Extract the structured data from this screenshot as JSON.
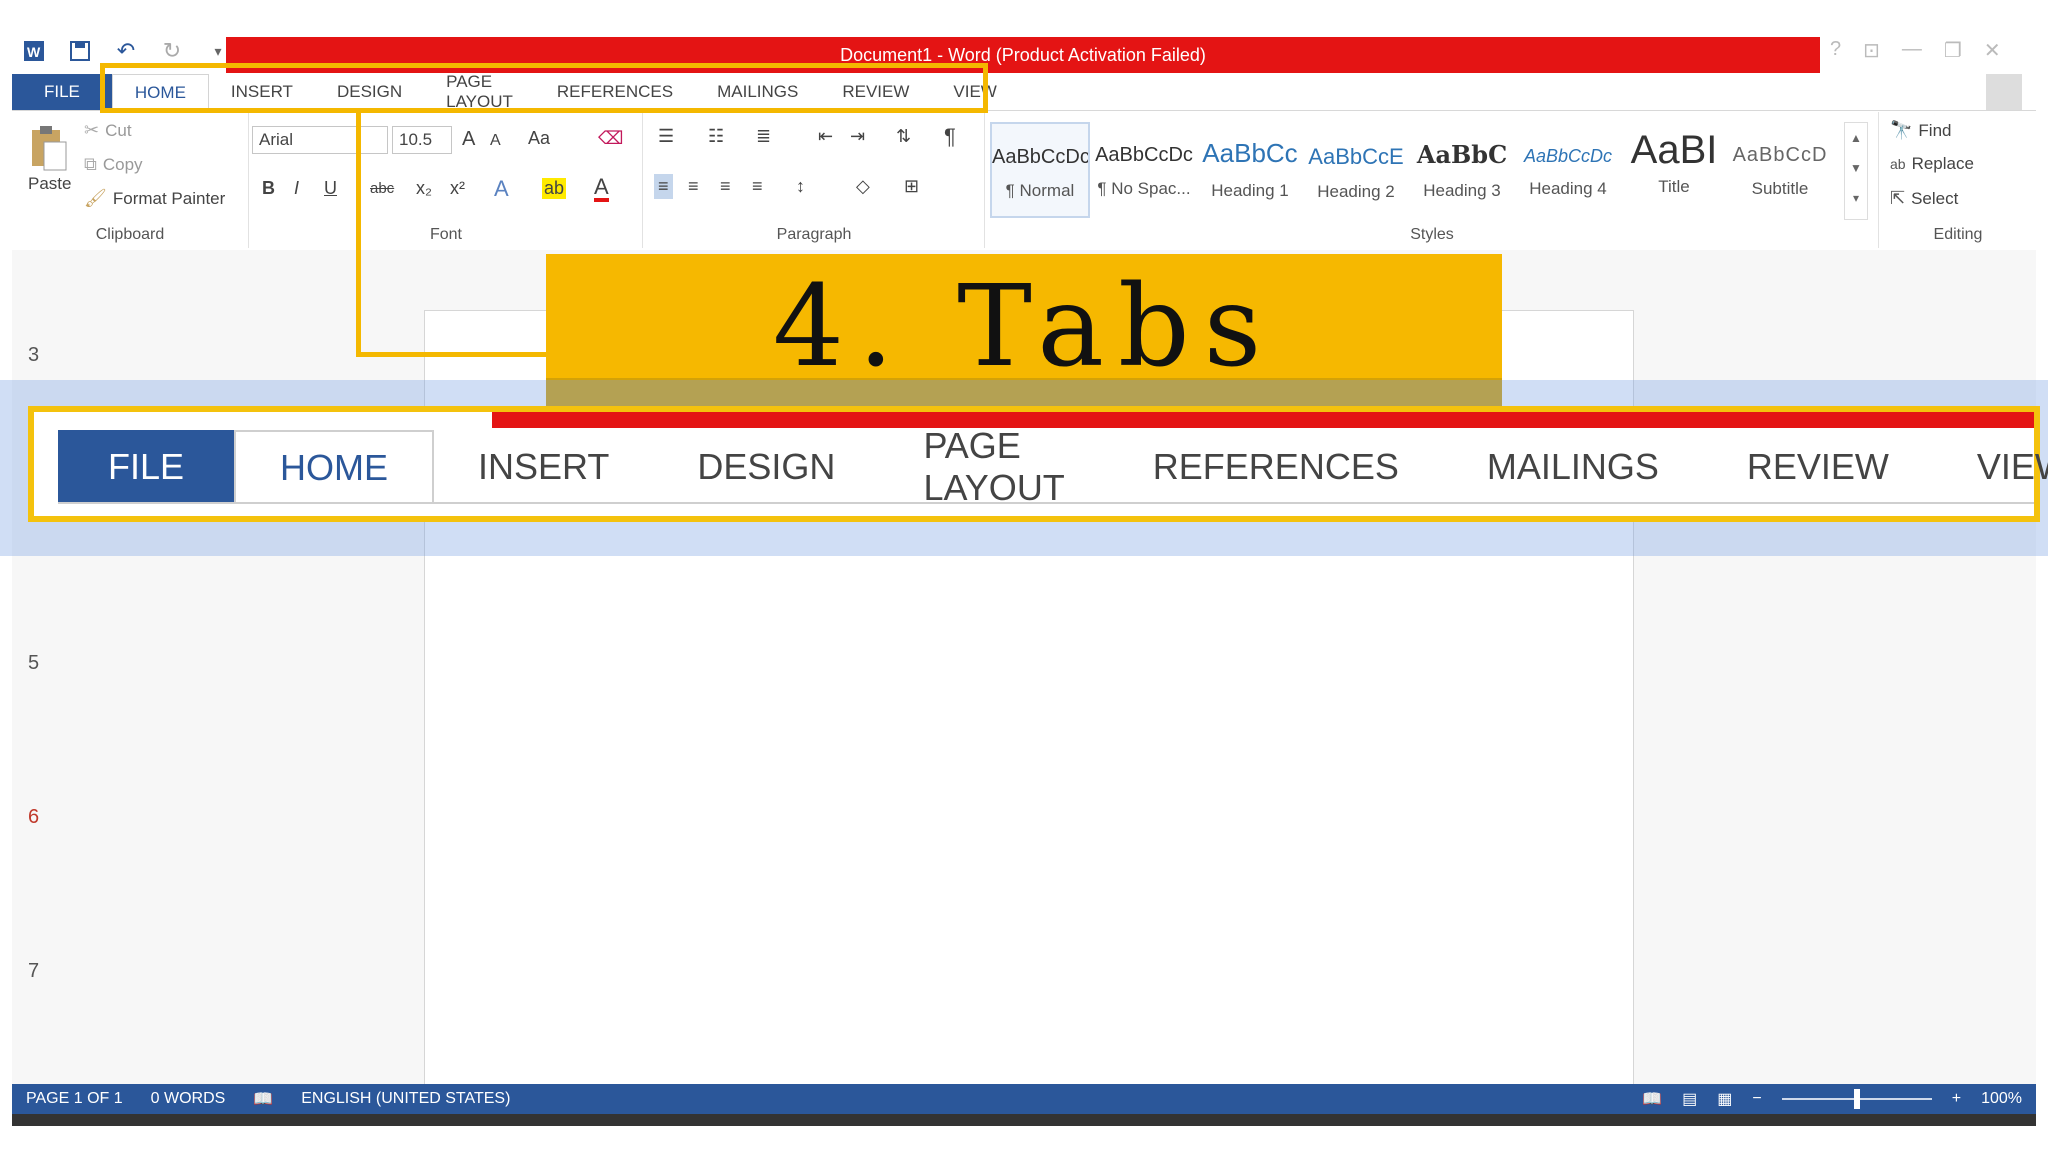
{
  "titlebar": {
    "title": "Document1 -  Word (Product Activation Failed)"
  },
  "window_controls": {
    "help": "?",
    "restore_ribbon": "⊡",
    "minimize": "—",
    "maximize": "❐",
    "close": "✕"
  },
  "tabs": [
    {
      "label": "FILE"
    },
    {
      "label": "HOME"
    },
    {
      "label": "INSERT"
    },
    {
      "label": "DESIGN"
    },
    {
      "label": "PAGE LAYOUT"
    },
    {
      "label": "REFERENCES"
    },
    {
      "label": "MAILINGS"
    },
    {
      "label": "REVIEW"
    },
    {
      "label": "VIEW"
    }
  ],
  "clipboard": {
    "paste": "Paste",
    "cut": "Cut",
    "copy": "Copy",
    "format_painter": "Format Painter",
    "label": "Clipboard"
  },
  "font": {
    "name": "Arial",
    "size": "10.5",
    "label": "Font",
    "change_case": "Aa",
    "bold": "B",
    "italic": "I",
    "underline": "U",
    "strikethrough": "abc",
    "subscript": "x₂",
    "superscript": "x²",
    "grow": "A",
    "shrink": "A",
    "text_effects": "A",
    "highlight": "ab",
    "font_color": "A"
  },
  "paragraph": {
    "label": "Paragraph"
  },
  "styles": {
    "label": "Styles",
    "items": [
      {
        "sample": "AaBbCcDc",
        "name": "¶ Normal"
      },
      {
        "sample": "AaBbCcDc",
        "name": "¶ No Spac..."
      },
      {
        "sample": "AaBbCc",
        "name": "Heading 1"
      },
      {
        "sample": "AaBbCcE",
        "name": "Heading 2"
      },
      {
        "sample": "AaBbC",
        "name": "Heading 3"
      },
      {
        "sample": "AaBbCcDc",
        "name": "Heading 4"
      },
      {
        "sample": "AaBI",
        "name": "Title"
      },
      {
        "sample": "AaBbCcD",
        "name": "Subtitle"
      }
    ]
  },
  "editing": {
    "find": "Find",
    "replace": "Replace",
    "select": "Select",
    "label": "Editing"
  },
  "banner": {
    "text": "4. Tabs"
  },
  "ruler_numbers": [
    "3",
    "5",
    "6",
    "7"
  ],
  "status": {
    "page": "PAGE 1 OF 1",
    "words": "0 WORDS",
    "language": "ENGLISH (UNITED STATES)",
    "zoom": "100%",
    "zoom_level": 0.5
  },
  "colors": {
    "accent": "#2b579a",
    "title_red": "#e41414",
    "highlight_yellow": "#f4b800"
  }
}
